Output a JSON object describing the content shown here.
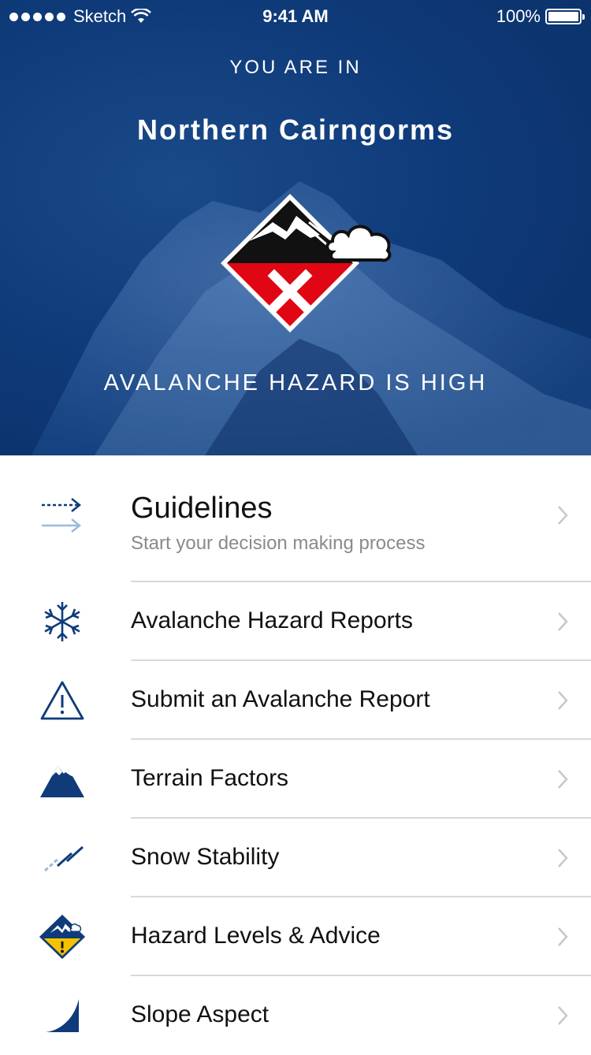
{
  "status_bar": {
    "carrier": "Sketch",
    "time": "9:41 AM",
    "battery": "100%"
  },
  "hero": {
    "eyebrow": "YOU ARE IN",
    "region": "Northern Cairngorms",
    "hazard_text": "AVALANCHE HAZARD IS HIGH"
  },
  "menu": {
    "items": [
      {
        "label": "Guidelines",
        "subtitle": "Start your decision making process",
        "icon": "arrows-icon"
      },
      {
        "label": "Avalanche Hazard Reports",
        "icon": "snowflake-icon"
      },
      {
        "label": "Submit an Avalanche Report",
        "icon": "warning-icon"
      },
      {
        "label": "Terrain Factors",
        "icon": "mountain-icon"
      },
      {
        "label": "Snow Stability",
        "icon": "slope-lines-icon"
      },
      {
        "label": "Hazard Levels & Advice",
        "icon": "hazard-diamond-icon"
      },
      {
        "label": "Slope Aspect",
        "icon": "slope-curve-icon"
      }
    ]
  },
  "colors": {
    "brand_blue": "#0f3b7a",
    "hazard_red": "#e10613",
    "warning_yellow": "#f4c300",
    "separator": "#d9d9d9",
    "chevron": "#c7c7cc"
  }
}
